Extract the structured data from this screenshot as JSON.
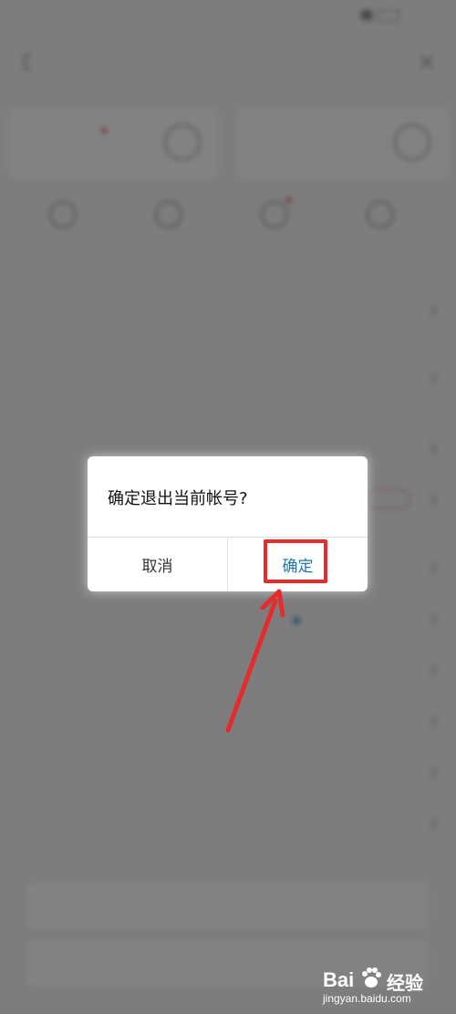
{
  "dialog": {
    "title": "确定退出当前帐号?",
    "cancel_label": "取消",
    "confirm_label": "确定"
  },
  "watermark": {
    "logo": "Bai",
    "logo_suffix": "经验",
    "url": "jingyan.baidu.com"
  },
  "colors": {
    "accent": "#1f74a8",
    "highlight": "#e52c2c",
    "overlay": "#4a4a4a"
  }
}
